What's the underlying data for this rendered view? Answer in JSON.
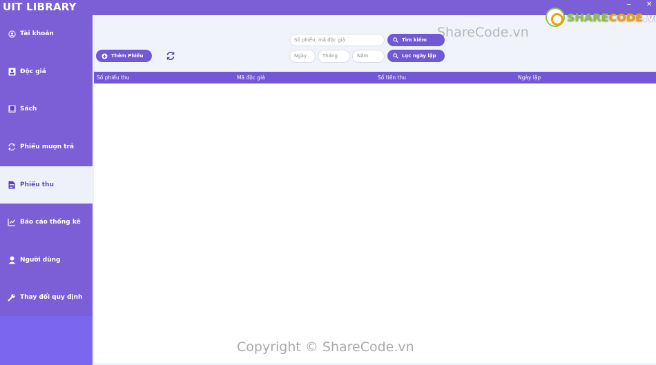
{
  "window": {
    "title": "UIT LIBRARY",
    "minimize": "–",
    "close": "✕"
  },
  "logo": {
    "part1": "SHARE",
    "part2": "CODE",
    "part3": ".vn"
  },
  "watermarks": {
    "top": "ShareCode.vn",
    "bottom": "Copyright © ShareCode.vn"
  },
  "sidebar": {
    "items": [
      {
        "label": "Tài khoản",
        "icon": "user-circle-icon"
      },
      {
        "label": "Độc giả",
        "icon": "id-card-icon"
      },
      {
        "label": "Sách",
        "icon": "book-icon"
      },
      {
        "label": "Phiếu mượn trả",
        "icon": "sync-icon"
      },
      {
        "label": "Phiếu thu",
        "icon": "document-icon",
        "active": true
      },
      {
        "label": "Báo cáo thống kê",
        "icon": "chart-icon"
      },
      {
        "label": "Người dùng",
        "icon": "person-icon"
      },
      {
        "label": "Thay đổi quy định",
        "icon": "wrench-icon"
      }
    ]
  },
  "toolbar": {
    "add_label": "Thêm Phiếu",
    "search_placeholder": "Số phiếu, mã độc giả",
    "search_label": "Tìm kiếm",
    "day_placeholder": "Ngày",
    "month_placeholder": "Tháng",
    "year_placeholder": "Năm",
    "filter_label": "Lọc ngày lập"
  },
  "table": {
    "columns": [
      "Số phiếu thu",
      "Mã độc giả",
      "Số tiền thu",
      "Ngày lập"
    ],
    "rows": []
  },
  "colors": {
    "sidebar": "#7a5fd6",
    "accent": "#7058d6",
    "active_bg": "#eef0fa",
    "content_bg": "#f1f3fb"
  }
}
